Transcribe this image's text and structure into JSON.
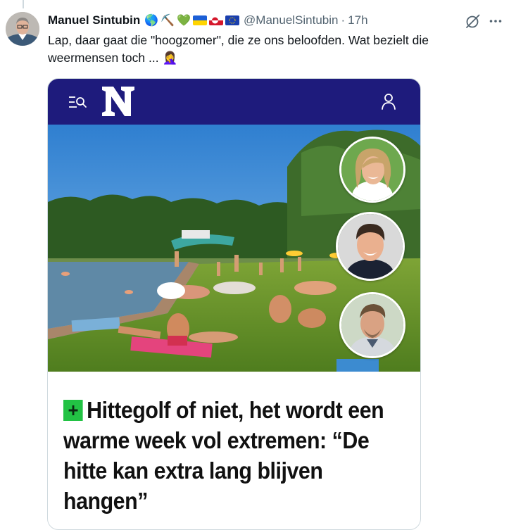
{
  "post": {
    "author_name": "Manuel Sintubin",
    "handle": "@ManuelSintubin",
    "separator": "·",
    "time": "17h",
    "text": "Lap, daar gaat die \"hoogzomer\", die ze ons beloofden. Wat bezielt die weermensen toch ... 🤦‍♀️",
    "name_emojis": [
      "🌎",
      "⛏️",
      "💚"
    ],
    "flags": [
      "ukraine-flag",
      "greenland-flag",
      "eu-flag"
    ]
  },
  "card": {
    "logo_letter": "N",
    "plus_symbol": "+",
    "headline": "Hittegolf of niet, het wordt een warme week vol extremen: “De hitte kan extra lang blijven hangen”",
    "nav_color": "#1e1b7c",
    "plus_color": "#22c244"
  },
  "icons": {
    "grok": "grok-icon",
    "more": "more-icon",
    "nav_search": "menu-search-icon",
    "nav_user": "user-icon"
  }
}
